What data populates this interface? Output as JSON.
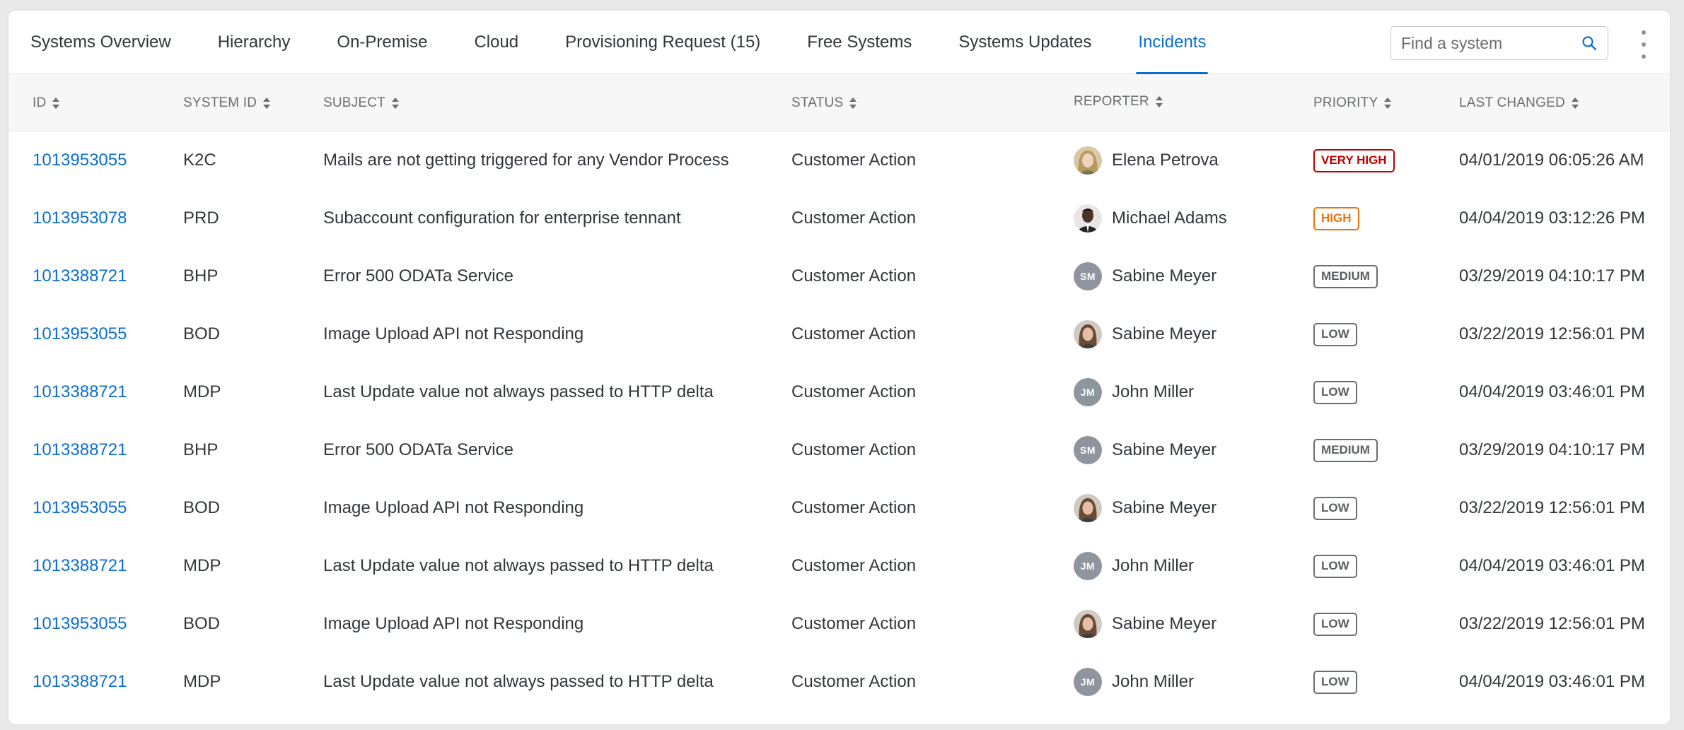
{
  "tabs": [
    {
      "label": "Systems Overview",
      "active": false
    },
    {
      "label": "Hierarchy",
      "active": false
    },
    {
      "label": "On-Premise",
      "active": false
    },
    {
      "label": "Cloud",
      "active": false
    },
    {
      "label": "Provisioning Request (15)",
      "active": false
    },
    {
      "label": "Free Systems",
      "active": false
    },
    {
      "label": "Systems Updates",
      "active": false
    },
    {
      "label": "Incidents",
      "active": true
    }
  ],
  "search": {
    "placeholder": "Find a system",
    "value": ""
  },
  "colors": {
    "accent": "#0a6ed1",
    "very_high": "#bb0000",
    "high": "#e9730c",
    "neutral_badge": "#6a6d70"
  },
  "columns": {
    "id": "ID",
    "system_id": "SYSTEM ID",
    "subject": "SUBJECT",
    "status": "STATUS",
    "reporter": "REPORTER",
    "priority": "PRIORITY",
    "last_changed": "LAST CHANGED"
  },
  "rows": [
    {
      "id": "1013953055",
      "system_id": "K2C",
      "subject": "Mails are not getting triggered for any Vendor Process",
      "status": "Customer Action",
      "reporter": "Elena Petrova",
      "avatar": "photo-blonde",
      "initials": "",
      "priority": "VERY HIGH",
      "priority_level": "very-high",
      "last_changed": "04/01/2019 06:05:26 AM"
    },
    {
      "id": "1013953078",
      "system_id": "PRD",
      "subject": "Subaccount configuration for enterprise tennant",
      "status": "Customer Action",
      "reporter": "Michael Adams",
      "avatar": "photo-dark",
      "initials": "",
      "priority": "HIGH",
      "priority_level": "high",
      "last_changed": "04/04/2019 03:12:26 PM"
    },
    {
      "id": "1013388721",
      "system_id": "BHP",
      "subject": "Error 500 ODATa Service",
      "status": "Customer Action",
      "reporter": "Sabine Meyer",
      "avatar": "initials",
      "initials": "SM",
      "priority": "MEDIUM",
      "priority_level": "medium",
      "last_changed": "03/29/2019 04:10:17 PM"
    },
    {
      "id": "1013953055",
      "system_id": "BOD",
      "subject": "Image Upload API not Responding",
      "status": "Customer Action",
      "reporter": "Sabine Meyer",
      "avatar": "photo-brown",
      "initials": "",
      "priority": "LOW",
      "priority_level": "low",
      "last_changed": "03/22/2019 12:56:01 PM"
    },
    {
      "id": "1013388721",
      "system_id": "MDP",
      "subject": "Last Update value not always passed to HTTP delta",
      "status": "Customer Action",
      "reporter": "John Miller",
      "avatar": "initials",
      "initials": "JM",
      "priority": "LOW",
      "priority_level": "low",
      "last_changed": "04/04/2019 03:46:01 PM"
    },
    {
      "id": "1013388721",
      "system_id": "BHP",
      "subject": "Error 500 ODATa Service",
      "status": "Customer Action",
      "reporter": "Sabine Meyer",
      "avatar": "initials",
      "initials": "SM",
      "priority": "MEDIUM",
      "priority_level": "medium",
      "last_changed": "03/29/2019 04:10:17 PM"
    },
    {
      "id": "1013953055",
      "system_id": "BOD",
      "subject": "Image Upload API not Responding",
      "status": "Customer Action",
      "reporter": "Sabine Meyer",
      "avatar": "photo-brown",
      "initials": "",
      "priority": "LOW",
      "priority_level": "low",
      "last_changed": "03/22/2019 12:56:01 PM"
    },
    {
      "id": "1013388721",
      "system_id": "MDP",
      "subject": "Last Update value not always passed to HTTP delta",
      "status": "Customer Action",
      "reporter": "John Miller",
      "avatar": "initials",
      "initials": "JM",
      "priority": "LOW",
      "priority_level": "low",
      "last_changed": "04/04/2019 03:46:01 PM"
    },
    {
      "id": "1013953055",
      "system_id": "BOD",
      "subject": "Image Upload API not Responding",
      "status": "Customer Action",
      "reporter": "Sabine Meyer",
      "avatar": "photo-brown",
      "initials": "",
      "priority": "LOW",
      "priority_level": "low",
      "last_changed": "03/22/2019 12:56:01 PM"
    },
    {
      "id": "1013388721",
      "system_id": "MDP",
      "subject": "Last Update value not always passed to HTTP delta",
      "status": "Customer Action",
      "reporter": "John Miller",
      "avatar": "initials",
      "initials": "JM",
      "priority": "LOW",
      "priority_level": "low",
      "last_changed": "04/04/2019 03:46:01 PM"
    }
  ]
}
